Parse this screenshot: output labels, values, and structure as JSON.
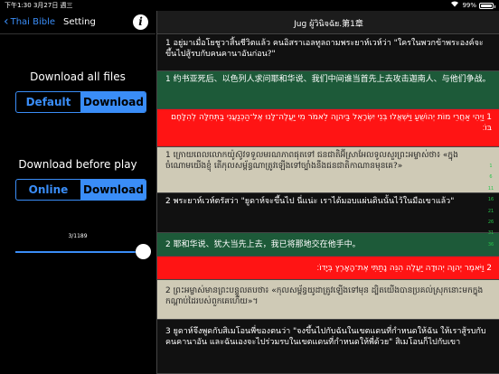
{
  "status": {
    "time": "下午1:30",
    "date": "3月27日 週三",
    "battery": "99%",
    "battery_level": 0.99
  },
  "settings": {
    "back_label": "Thai Bible",
    "title": "Setting",
    "info_icon": "i",
    "download_all": {
      "title": "Download all files",
      "options": [
        "Default",
        "Download"
      ],
      "selected": "Download"
    },
    "download_before_play": {
      "title": "Download before play",
      "options": [
        "Online",
        "Download"
      ],
      "selected": "Download"
    },
    "progress_text": "3/1189",
    "slider_value": 1.0
  },
  "reader": {
    "title": "Jug ผู้วินิจฉัย.第1章",
    "verses": [
      {
        "style": "black",
        "text": "1 อยู่มาเมื่อโยชูวาสิ้นชีวิตแล้ว คนอิสราเอลทูลถามพระยาห์เวห์ว่า \"ใครในพวกข้าพระองค์จะขึ้นไปสู้รบกับคนคานาอันก่อน?\""
      },
      {
        "style": "green",
        "text": "1 约书亚死后、以色列人求问耶和华说、我们中间谁当首先上去攻击迦南人、与他们争战。"
      },
      {
        "style": "red",
        "text": "1 וַיְהִי אַחֲרֵי מוֹת יְהוֹשֻׁעַ וַיִּשְׁאֲלוּ בְּנֵי יִשְׂרָאֵל בַּיהוָה לֵאמֹר מִי יַעֲלֶה־לָּנוּ אֶל־הַכְּנַעֲנִי בַּתְּחִלָּה לְהִלָּחֶם בּוֹ׃"
      },
      {
        "style": "tan",
        "text": "1 ក្រោយពេលលោកយ៉ូស៊ូវទទួលមរណភាពផុតទៅ ជនជាតិអ៊ីស្រាអែលទូលសួរព្រះអម្ចាស់ថា៖ «ក្នុងចំណោមយើងខ្ញុំ តើកុលសម្ព័ន្ធណាត្រូវឡើងទៅច្បាំងនឹងជនជាតិកាណានមុនគេ?»"
      },
      {
        "style": "black",
        "text": "2 พระยาห์เวห์ตรัสว่า \"ยูดาห์จะขึ้นไป นี่แน่ะ เราได้มอบแผ่นดินนั้นไว้ในมือเขาแล้ว\""
      },
      {
        "style": "green",
        "text": "2 耶和华说、犹大当先上去，我已将那地交在他手中。"
      },
      {
        "style": "red",
        "text": "2 וַיֹּאמֶר יְהוָה יְהוּדָה יַעֲלֶה הִנֵּה נָתַתִּי אֶת־הָאָרֶץ בְּיָדוֹ׃"
      },
      {
        "style": "tan",
        "text": "2 ព្រះអម្ចាស់មានព្រះបន្ទូលតបថា៖ «កុលសម្ព័ន្ធយូដាត្រូវឡើងទៅមុន ដ្បិតយើងបានប្រគល់ស្រុកនោះមកក្នុងកណ្ដាប់ដៃរបស់ពួកគេហើយ»។"
      },
      {
        "style": "black",
        "text": "3 ยูดาห์จึงพูดกับสิเมโอนพี่ของตนว่า \"จงขึ้นไปกับฉันในเขตแดนที่กำหนดให้ฉัน ให้เราสู้รบกับคนคานาอัน และฉันเองจะไปร่วมรบในเขตแดนที่กำหนดให้พี่ด้วย\" สิเมโอนก็ไปกับเขา"
      }
    ],
    "index": [
      "1",
      "6",
      "11",
      "16",
      "21",
      "26",
      "31",
      "36"
    ]
  }
}
